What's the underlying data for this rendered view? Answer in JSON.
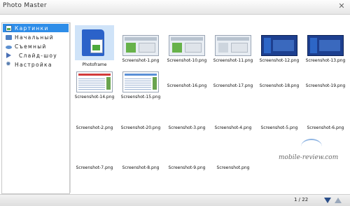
{
  "window": {
    "title": "Photo Master"
  },
  "sidebar": {
    "items": [
      {
        "label": "Картинки",
        "icon": "pictures-icon",
        "active": true
      },
      {
        "label": "Начальный",
        "icon": "monitor-icon",
        "active": false
      },
      {
        "label": "Съемный",
        "icon": "disk-icon",
        "active": false
      },
      {
        "label": "Слайд-шоу",
        "icon": "play-icon",
        "active": false
      },
      {
        "label": "Настройка",
        "icon": "gear-icon",
        "active": false
      }
    ]
  },
  "gallery": {
    "items": [
      {
        "label": "Photoframe"
      },
      {
        "label": "Screenshot-1.png"
      },
      {
        "label": "Screenshot-10.png"
      },
      {
        "label": "Screenshot-11.png"
      },
      {
        "label": "Screenshot-12.png"
      },
      {
        "label": "Screenshot-13.png"
      },
      {
        "label": "Screenshot-14.png"
      },
      {
        "label": "Screenshot-15.png"
      },
      {
        "label": "Screenshot-16.png"
      },
      {
        "label": "Screenshot-17.png"
      },
      {
        "label": "Screenshot-18.png"
      },
      {
        "label": "Screenshot-19.png"
      },
      {
        "label": "Screenshot-2.png"
      },
      {
        "label": "Screenshot-20.png"
      },
      {
        "label": "Screenshot-3.png"
      },
      {
        "label": "Screenshot-4.png"
      },
      {
        "label": "Screenshot-5.png"
      },
      {
        "label": "Screenshot-6.png"
      },
      {
        "label": "Screenshot-7.png"
      },
      {
        "label": "Screenshot-8.png"
      },
      {
        "label": "Screenshot-9.png"
      },
      {
        "label": "Screenshot.png"
      }
    ]
  },
  "status": {
    "page": "1 / 22"
  },
  "watermark": {
    "text": "mobile-review.com"
  }
}
